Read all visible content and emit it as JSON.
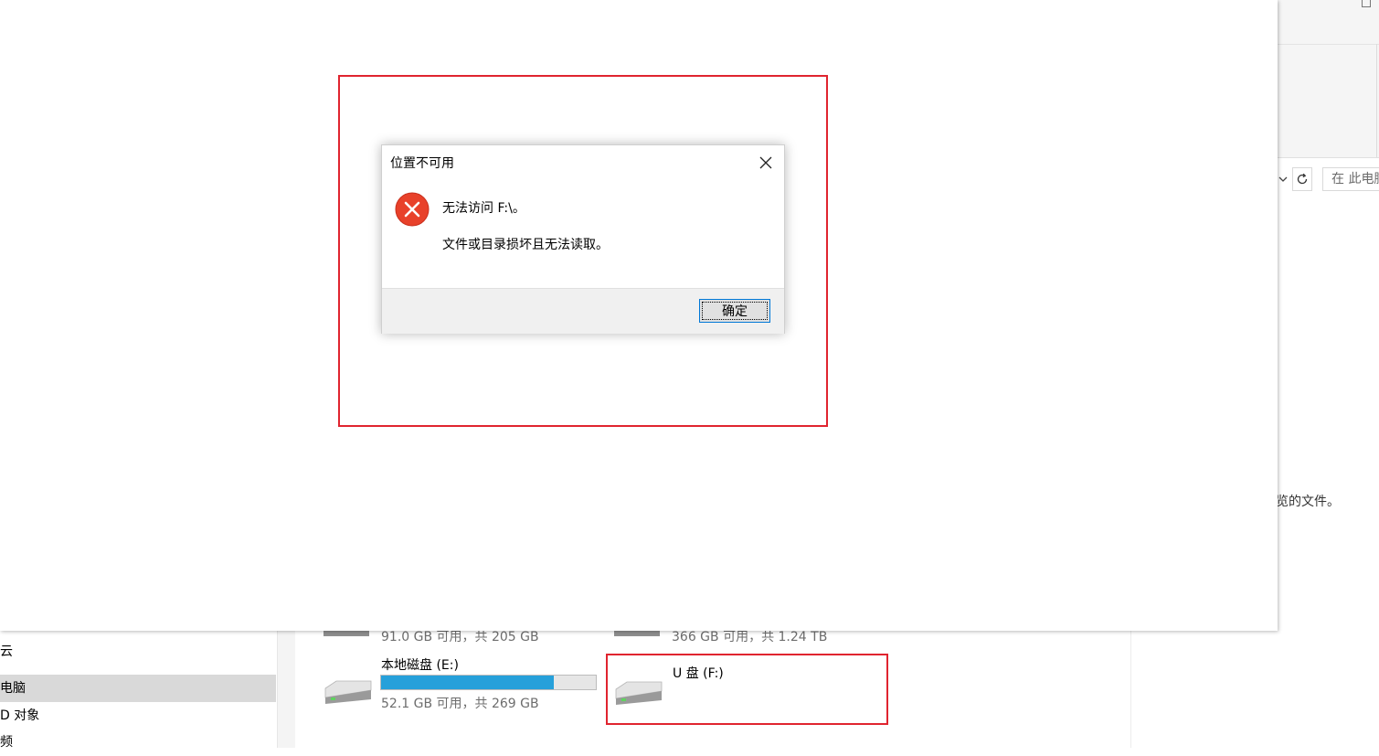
{
  "explorer": {
    "search_placeholder": "在 此电脑",
    "preview_hint": "览的文件。",
    "nav_items": [
      {
        "label": "云",
        "selected": false
      },
      {
        "label": "电脑",
        "selected": true
      },
      {
        "label": "D 对象",
        "selected": false
      },
      {
        "label": "频",
        "selected": false
      }
    ],
    "drives": [
      {
        "free_text": "91.0 GB 可用，共 205 GB"
      },
      {
        "free_text": "366 GB 可用，共 1.24 TB"
      },
      {
        "name": "本地磁盘 (E:)",
        "free_text": "52.1 GB 可用，共 269 GB",
        "used_fraction": 0.806
      },
      {
        "name": "U 盘 (F:)"
      }
    ]
  },
  "dialog": {
    "title": "位置不可用",
    "message_line1": "无法访问 F:\\。",
    "message_line2": "文件或目录损坏且无法读取。",
    "ok_label": "确定"
  },
  "colors": {
    "highlight_border": "#e0242f",
    "error_icon": "#e8412a",
    "progress_fill": "#26a0da",
    "button_border": "#0078d7"
  },
  "icons": {
    "close": "close-icon",
    "error": "error-icon",
    "drive": "drive-icon",
    "refresh": "refresh-icon",
    "chevron": "chevron-down-icon"
  }
}
